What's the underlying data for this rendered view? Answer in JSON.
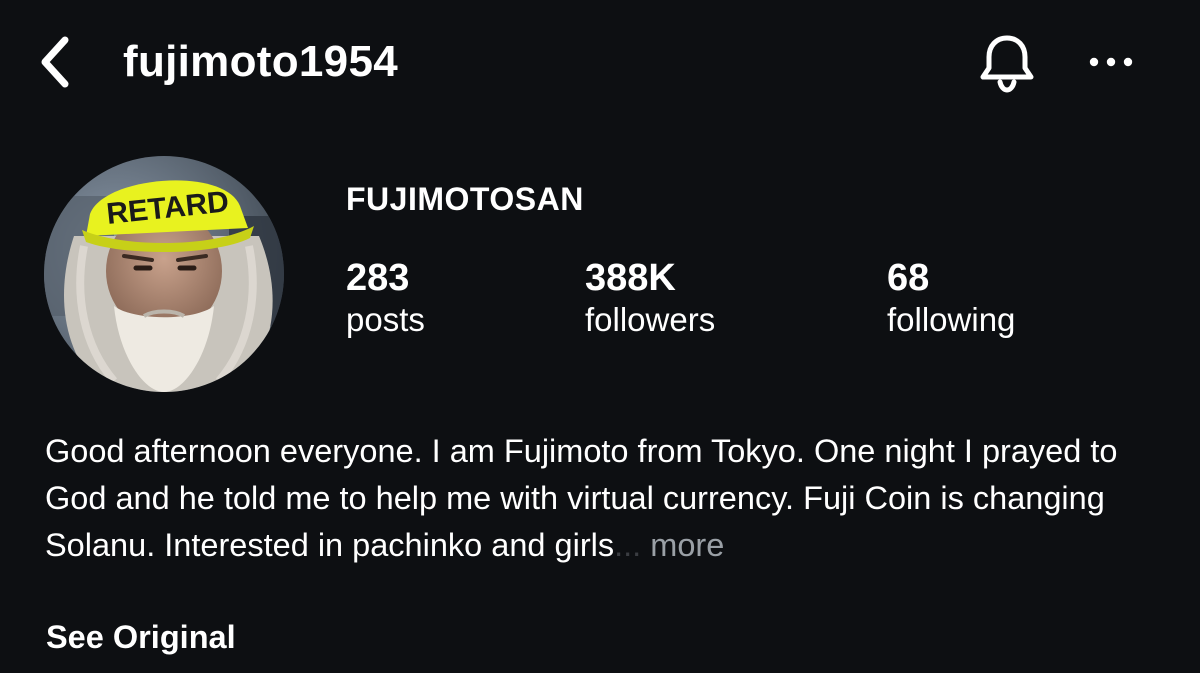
{
  "header": {
    "username": "fujimoto1954",
    "back_icon": "chevron-left-icon",
    "notification_icon": "bell-icon",
    "more_icon": "ellipsis-horizontal-icon"
  },
  "profile": {
    "display_name": "FUJIMOTOSAN",
    "avatar": {
      "description_icon": "profile-photo",
      "hat_text": "RETARD"
    },
    "stats": [
      {
        "value": "283",
        "label": "posts"
      },
      {
        "value": "388K",
        "label": "followers"
      },
      {
        "value": "68",
        "label": "following"
      }
    ],
    "bio": {
      "text": "Good afternoon everyone. I am Fujimoto from Tokyo. One night I prayed to God and he told me to help me with virtual currency. Fuji Coin is changing Solanu. Interested in pachinko and girls",
      "ellipsis": "...",
      "more_label": " more"
    },
    "see_original_label": "See Original"
  },
  "colors": {
    "background": "#0d0f12",
    "text": "#ffffff",
    "muted": "#9aa0a6",
    "hat_yellow": "#e8f21f"
  }
}
